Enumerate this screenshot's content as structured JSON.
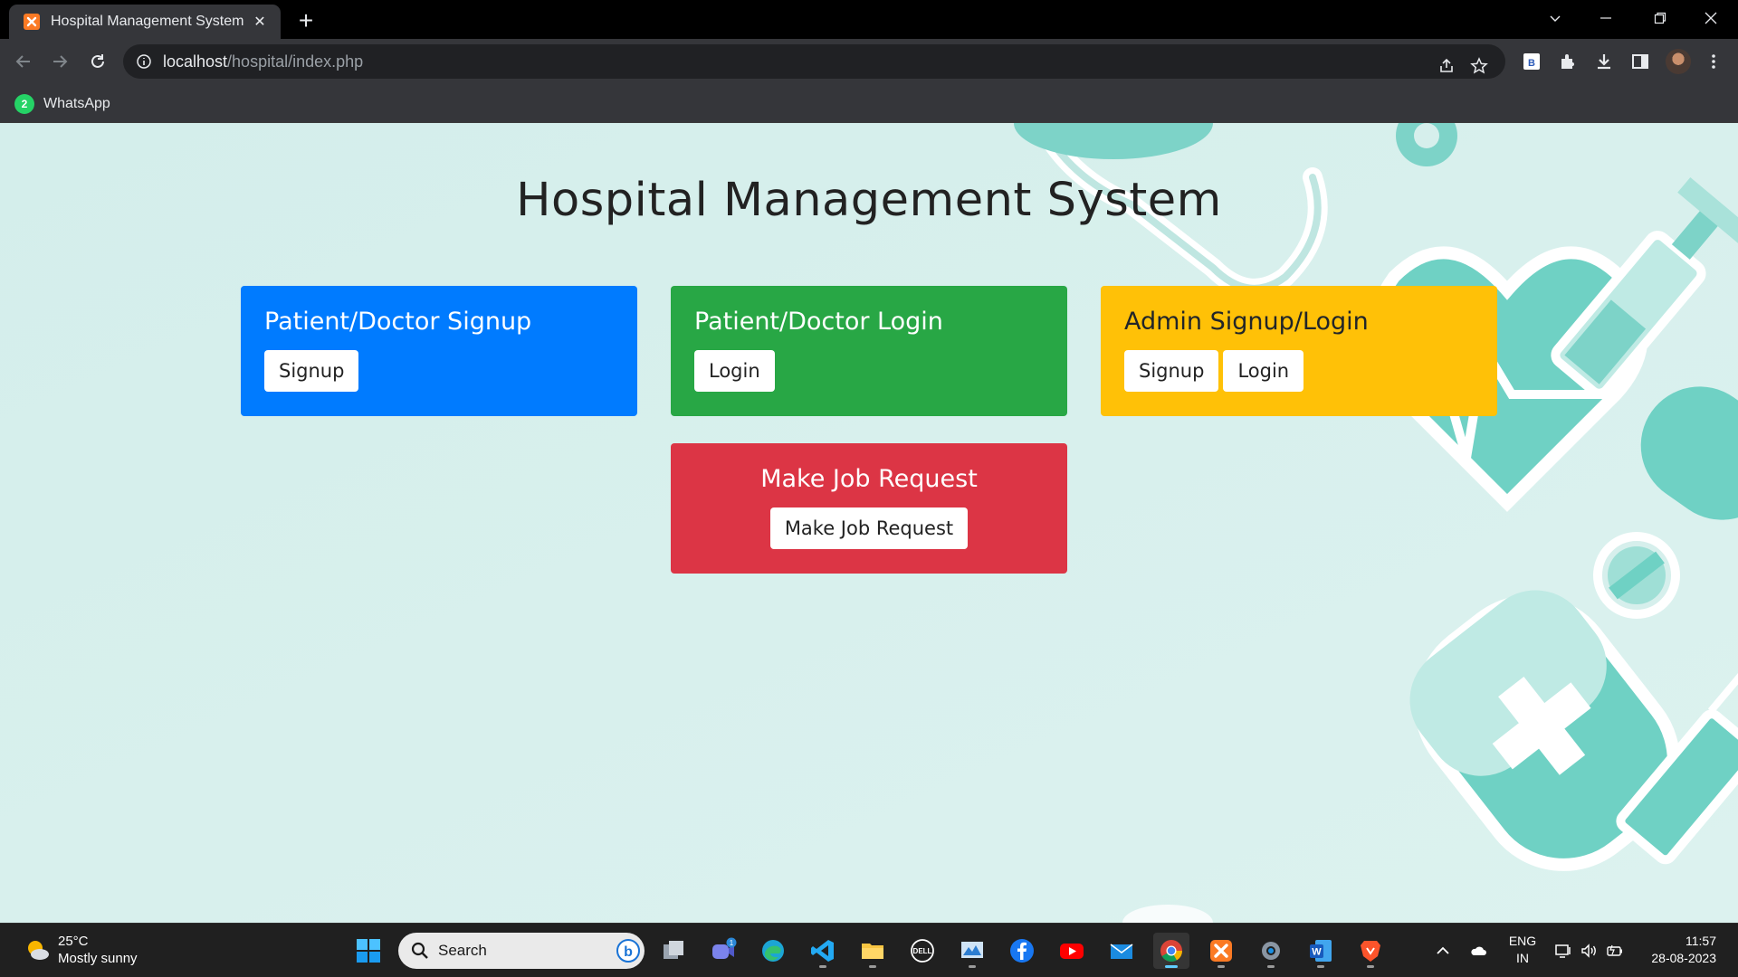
{
  "browser": {
    "tab_title": "Hospital Management System",
    "url_host": "localhost",
    "url_path": "/hospital/index.php",
    "bookmark_label": "WhatsApp",
    "bookmark_badge": "2"
  },
  "page": {
    "title": "Hospital Management System",
    "cards": [
      {
        "title": "Patient/Doctor Signup",
        "buttons": [
          "Signup"
        ],
        "color": "#007bff"
      },
      {
        "title": "Patient/Doctor Login",
        "buttons": [
          "Login"
        ],
        "color": "#28a745"
      },
      {
        "title": "Admin Signup/Login",
        "buttons": [
          "Signup",
          "Login"
        ],
        "color": "#ffc107"
      },
      {
        "title": "Make Job Request",
        "buttons": [
          "Make Job Request"
        ],
        "color": "#dc3545"
      }
    ]
  },
  "taskbar": {
    "weather_temp": "25°C",
    "weather_desc": "Mostly sunny",
    "search_label": "Search",
    "chat_badge": "1",
    "lang_line1": "ENG",
    "lang_line2": "IN",
    "time": "11:57",
    "date": "28-08-2023"
  }
}
